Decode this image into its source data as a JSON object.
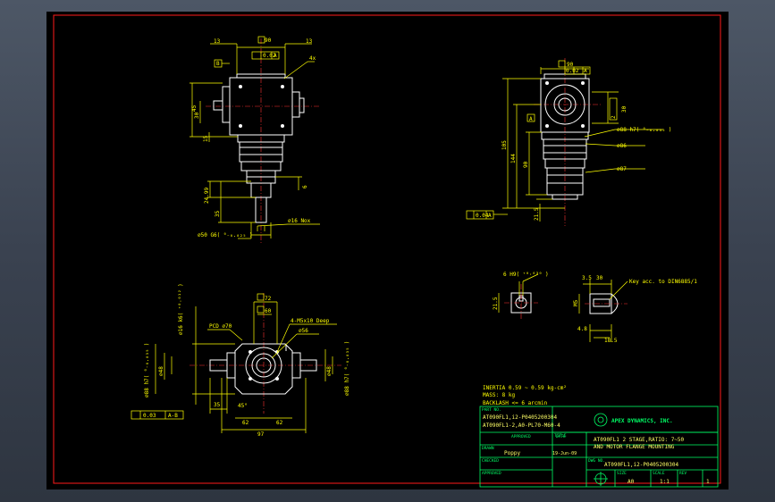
{
  "colors": {
    "background": "#000000",
    "frame": "#ff1a1a",
    "geometry": "#ffffff",
    "dimension": "#ffff00",
    "note": "#ffff00",
    "titleblock": "#00ff66",
    "center": "#ff3333"
  },
  "front": {
    "d_top": "90",
    "d13a": "13",
    "d13b": "13",
    "gdt": "0.02",
    "datum": "A",
    "datum_b": "B",
    "d4x": "4x",
    "d45": "45",
    "d30": "30",
    "d15": "15",
    "d24": "24.99",
    "d35": "35",
    "d6": "6",
    "d_shaft": "⌀16 Nox",
    "d_flange": "⌀50 G6( ⁰₋₀.₀₂₅ )"
  },
  "side": {
    "d_top": "90",
    "gdt": "0.02",
    "datum_a": "A",
    "d2": "2",
    "d30": "30",
    "d105": "105",
    "d144": "144",
    "d90": "90",
    "d215": "21.5",
    "d88": "⌀88 h7( ⁰₋₀.₀₃₅ )",
    "d86": "⌀86",
    "d87": "⌀87",
    "gdt_bot": "0.04",
    "datum_bot": "A"
  },
  "bottom": {
    "d72": "72",
    "d60": "60",
    "pcd": "PCD ⌀70",
    "holes": "4-M5x10 Deep",
    "d56": "⌀56",
    "dv": "⌀16 k6( ⁺⁰·⁰¹² )",
    "d1": "⌀88 h7( ⁰₋₀.₀₃₅ )",
    "d2": "⌀48",
    "d3": "⌀88 h7( ⁰₋₀.₀₃₅ )",
    "d4": "⌀48",
    "d35": "35",
    "d45": "45°",
    "d62a": "62",
    "d62b": "62",
    "d97": "97",
    "gdt": "0.03",
    "datum": "A-B"
  },
  "key": {
    "a_label": "6 H9( ⁺⁰·⁰³⁰ )",
    "a_dim": "21.5",
    "b_35": "3.5",
    "b_30": "30",
    "b_m5": "M5",
    "b_48": "4.8",
    "b_185": "18.5",
    "note": "Key acc. to DIN6885/1"
  },
  "notes": {
    "l1": "INERTIA  0.59 ~ 0.59 kg-cm²",
    "l2": "MASS: 8 kg",
    "l3": "BACKLASH <= 6 arcmin"
  },
  "tb": {
    "part_no_h": "PART NO.",
    "part1": "AT090FL1,i2-P0405200304",
    "part2": "AT090FL1-2,A0-PL70-M60-4",
    "approved_h": "APPROVED",
    "date_h": "DATE",
    "drawn_h": "DRAWN",
    "drawn": "Poppy",
    "date": "19-Jun-09",
    "checked_h": "CHECKED",
    "approved2_h": "APPROVED",
    "company": "APEX DYNAMICS, INC.",
    "title_h": "TITLE",
    "title1": "AT090FL1 2 STAGE,RATIO: 7~50",
    "title2": "AND MOTOR FLANGE MOUNTING",
    "dwg_h": "DWG NO.",
    "dwg": "AT090FL1,i2-P0405200304",
    "size_h": "SIZE",
    "size": "A0",
    "scale_h": "SCALE",
    "scale": "1:1",
    "rev_h": "REV",
    "rev": "1"
  }
}
